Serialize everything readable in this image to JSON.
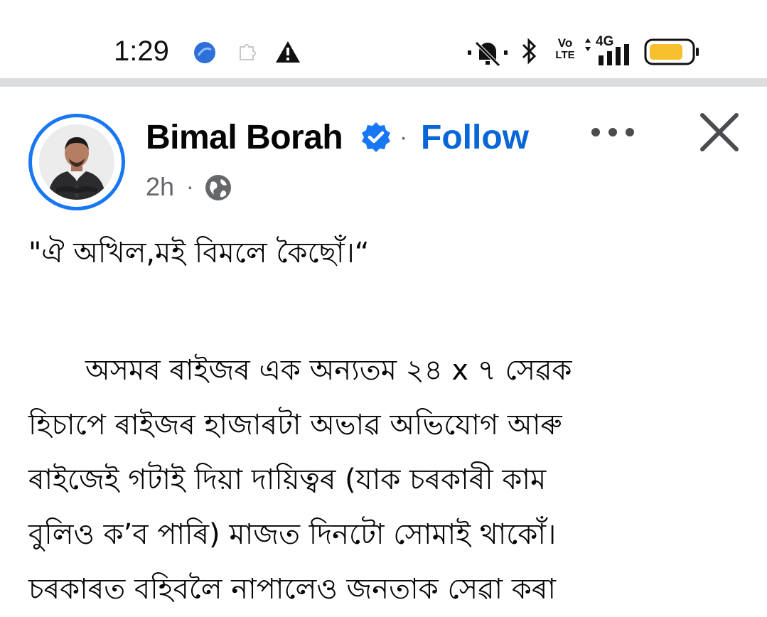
{
  "status_bar": {
    "time": "1:29",
    "left_icons": [
      "app-bubble-icon",
      "puzzle-icon",
      "warning-icon"
    ],
    "right_icons": [
      "muted-bell-icon",
      "bluetooth-icon",
      "volte-icon",
      "signal-4g-icon",
      "battery-icon"
    ],
    "volte_top": "Vo",
    "volte_bottom": "LTE",
    "network_label": "4G",
    "battery_color": "#f6c12c"
  },
  "post": {
    "author": "Bimal Borah",
    "verified": true,
    "separator": "·",
    "follow_label": "Follow",
    "timestamp": "2h",
    "meta_separator": "·",
    "audience_icon": "globe-icon",
    "lines": [
      "\"ঐ অখিল,মই বিমলে কৈছোঁ।“",
      "অসমৰ ৰাইজৰ এক অন্যতম ২৪ x ৭ সেৱক",
      "হিচাপে ৰাইজৰ হাজাৰটা অভাৱ অভিযোগ আৰু",
      "ৰাইজেই গটাই দিয়া দায়িত্বৰ (যাক চৰকাৰী কাম",
      "বুলিও ক’ব পাৰি) মাজত দিনটো সোমাই থাকোঁ।",
      "চৰকাৰত বহিবলৈ নাপালেও জনতাক সেৱা কৰা"
    ]
  },
  "colors": {
    "accent": "#0866d6",
    "avatar_ring": "#1877f2",
    "secondary_text": "#65676b",
    "divider": "#dcdde0"
  }
}
